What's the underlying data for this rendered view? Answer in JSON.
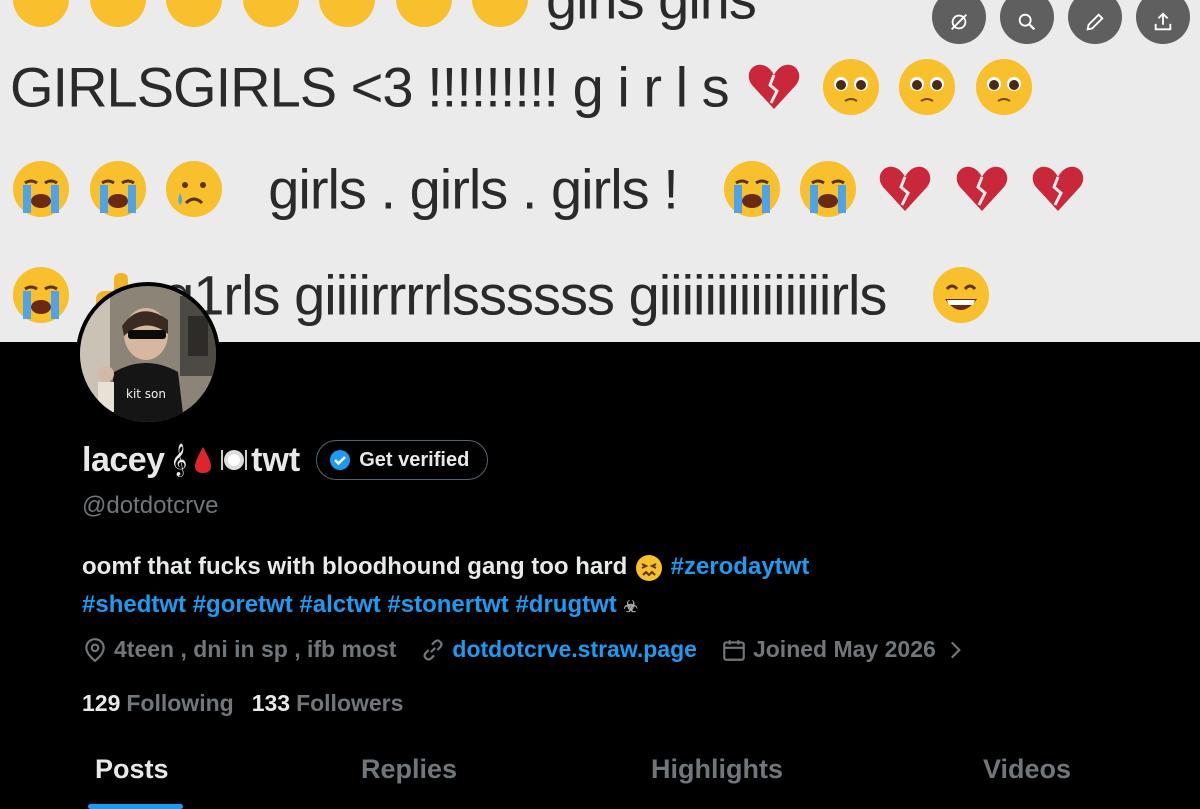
{
  "banner": {
    "line0": "girls girls",
    "line1": "GIRLSGIRLS <3 !!!!!!!!! g i r l s",
    "line2": "girls . girls . girls !",
    "line3": "g1rls giiiirrrrlssssss giiiiiiiiiiiiiiirls"
  },
  "profile": {
    "name": "lacey",
    "name_glyph": "𝄞",
    "name_suffix": "twt",
    "verify_label": "Get verified",
    "handle": "@dotdotcrve",
    "avatar_text": "kit son",
    "bio_text": "oomf that fucks with bloodhound gang too hard",
    "hashtags_line1": "#zerodaytwt",
    "hashtags_line2": [
      "#shedtwt",
      "#goretwt",
      "#alctwt",
      "#stonertwt",
      "#drugtwt"
    ],
    "bio_end_glyph": "☣",
    "location": "4teen , dni in sp , ifb most",
    "website": "dotdotcrve.straw.page",
    "joined": "Joined May 2026",
    "following_count": "129",
    "following_label": "Following",
    "followers_count": "133",
    "followers_label": "Followers"
  },
  "tabs": [
    "Posts",
    "Replies",
    "Highlights",
    "Videos"
  ],
  "colors": {
    "accent": "#1d9bf0",
    "muted": "#71767b",
    "text": "#e7e9ea",
    "background": "#000000"
  }
}
